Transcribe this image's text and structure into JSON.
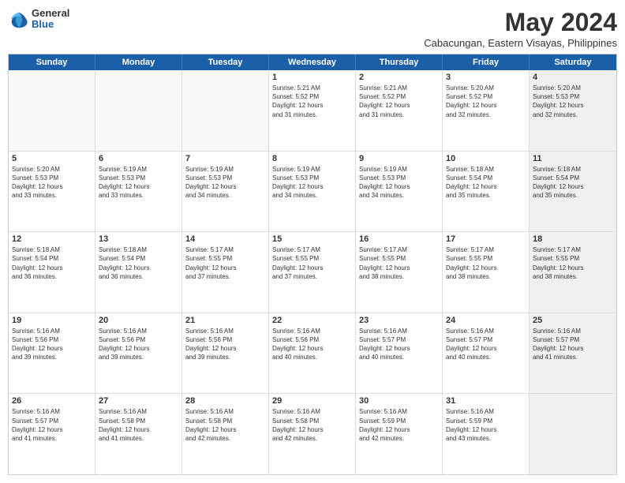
{
  "header": {
    "logo": {
      "general": "General",
      "blue": "Blue"
    },
    "title": "May 2024",
    "location": "Cabacungan, Eastern Visayas, Philippines"
  },
  "weekdays": [
    "Sunday",
    "Monday",
    "Tuesday",
    "Wednesday",
    "Thursday",
    "Friday",
    "Saturday"
  ],
  "rows": [
    [
      {
        "day": "",
        "info": "",
        "empty": true
      },
      {
        "day": "",
        "info": "",
        "empty": true
      },
      {
        "day": "",
        "info": "",
        "empty": true
      },
      {
        "day": "1",
        "info": "Sunrise: 5:21 AM\nSunset: 5:52 PM\nDaylight: 12 hours\nand 31 minutes.",
        "empty": false
      },
      {
        "day": "2",
        "info": "Sunrise: 5:21 AM\nSunset: 5:52 PM\nDaylight: 12 hours\nand 31 minutes.",
        "empty": false
      },
      {
        "day": "3",
        "info": "Sunrise: 5:20 AM\nSunset: 5:52 PM\nDaylight: 12 hours\nand 32 minutes.",
        "empty": false
      },
      {
        "day": "4",
        "info": "Sunrise: 5:20 AM\nSunset: 5:53 PM\nDaylight: 12 hours\nand 32 minutes.",
        "empty": false,
        "shaded": true
      }
    ],
    [
      {
        "day": "5",
        "info": "Sunrise: 5:20 AM\nSunset: 5:53 PM\nDaylight: 12 hours\nand 33 minutes.",
        "empty": false
      },
      {
        "day": "6",
        "info": "Sunrise: 5:19 AM\nSunset: 5:53 PM\nDaylight: 12 hours\nand 33 minutes.",
        "empty": false
      },
      {
        "day": "7",
        "info": "Sunrise: 5:19 AM\nSunset: 5:53 PM\nDaylight: 12 hours\nand 34 minutes.",
        "empty": false
      },
      {
        "day": "8",
        "info": "Sunrise: 5:19 AM\nSunset: 5:53 PM\nDaylight: 12 hours\nand 34 minutes.",
        "empty": false
      },
      {
        "day": "9",
        "info": "Sunrise: 5:19 AM\nSunset: 5:53 PM\nDaylight: 12 hours\nand 34 minutes.",
        "empty": false
      },
      {
        "day": "10",
        "info": "Sunrise: 5:18 AM\nSunset: 5:54 PM\nDaylight: 12 hours\nand 35 minutes.",
        "empty": false
      },
      {
        "day": "11",
        "info": "Sunrise: 5:18 AM\nSunset: 5:54 PM\nDaylight: 12 hours\nand 35 minutes.",
        "empty": false,
        "shaded": true
      }
    ],
    [
      {
        "day": "12",
        "info": "Sunrise: 5:18 AM\nSunset: 5:54 PM\nDaylight: 12 hours\nand 36 minutes.",
        "empty": false
      },
      {
        "day": "13",
        "info": "Sunrise: 5:18 AM\nSunset: 5:54 PM\nDaylight: 12 hours\nand 36 minutes.",
        "empty": false
      },
      {
        "day": "14",
        "info": "Sunrise: 5:17 AM\nSunset: 5:55 PM\nDaylight: 12 hours\nand 37 minutes.",
        "empty": false
      },
      {
        "day": "15",
        "info": "Sunrise: 5:17 AM\nSunset: 5:55 PM\nDaylight: 12 hours\nand 37 minutes.",
        "empty": false
      },
      {
        "day": "16",
        "info": "Sunrise: 5:17 AM\nSunset: 5:55 PM\nDaylight: 12 hours\nand 38 minutes.",
        "empty": false
      },
      {
        "day": "17",
        "info": "Sunrise: 5:17 AM\nSunset: 5:55 PM\nDaylight: 12 hours\nand 38 minutes.",
        "empty": false
      },
      {
        "day": "18",
        "info": "Sunrise: 5:17 AM\nSunset: 5:55 PM\nDaylight: 12 hours\nand 38 minutes.",
        "empty": false,
        "shaded": true
      }
    ],
    [
      {
        "day": "19",
        "info": "Sunrise: 5:16 AM\nSunset: 5:56 PM\nDaylight: 12 hours\nand 39 minutes.",
        "empty": false
      },
      {
        "day": "20",
        "info": "Sunrise: 5:16 AM\nSunset: 5:56 PM\nDaylight: 12 hours\nand 39 minutes.",
        "empty": false
      },
      {
        "day": "21",
        "info": "Sunrise: 5:16 AM\nSunset: 5:56 PM\nDaylight: 12 hours\nand 39 minutes.",
        "empty": false
      },
      {
        "day": "22",
        "info": "Sunrise: 5:16 AM\nSunset: 5:56 PM\nDaylight: 12 hours\nand 40 minutes.",
        "empty": false
      },
      {
        "day": "23",
        "info": "Sunrise: 5:16 AM\nSunset: 5:57 PM\nDaylight: 12 hours\nand 40 minutes.",
        "empty": false
      },
      {
        "day": "24",
        "info": "Sunrise: 5:16 AM\nSunset: 5:57 PM\nDaylight: 12 hours\nand 40 minutes.",
        "empty": false
      },
      {
        "day": "25",
        "info": "Sunrise: 5:16 AM\nSunset: 5:57 PM\nDaylight: 12 hours\nand 41 minutes.",
        "empty": false,
        "shaded": true
      }
    ],
    [
      {
        "day": "26",
        "info": "Sunrise: 5:16 AM\nSunset: 5:57 PM\nDaylight: 12 hours\nand 41 minutes.",
        "empty": false
      },
      {
        "day": "27",
        "info": "Sunrise: 5:16 AM\nSunset: 5:58 PM\nDaylight: 12 hours\nand 41 minutes.",
        "empty": false
      },
      {
        "day": "28",
        "info": "Sunrise: 5:16 AM\nSunset: 5:58 PM\nDaylight: 12 hours\nand 42 minutes.",
        "empty": false
      },
      {
        "day": "29",
        "info": "Sunrise: 5:16 AM\nSunset: 5:58 PM\nDaylight: 12 hours\nand 42 minutes.",
        "empty": false
      },
      {
        "day": "30",
        "info": "Sunrise: 5:16 AM\nSunset: 5:59 PM\nDaylight: 12 hours\nand 42 minutes.",
        "empty": false
      },
      {
        "day": "31",
        "info": "Sunrise: 5:16 AM\nSunset: 5:59 PM\nDaylight: 12 hours\nand 43 minutes.",
        "empty": false
      },
      {
        "day": "",
        "info": "",
        "empty": true,
        "shaded": true
      }
    ]
  ]
}
